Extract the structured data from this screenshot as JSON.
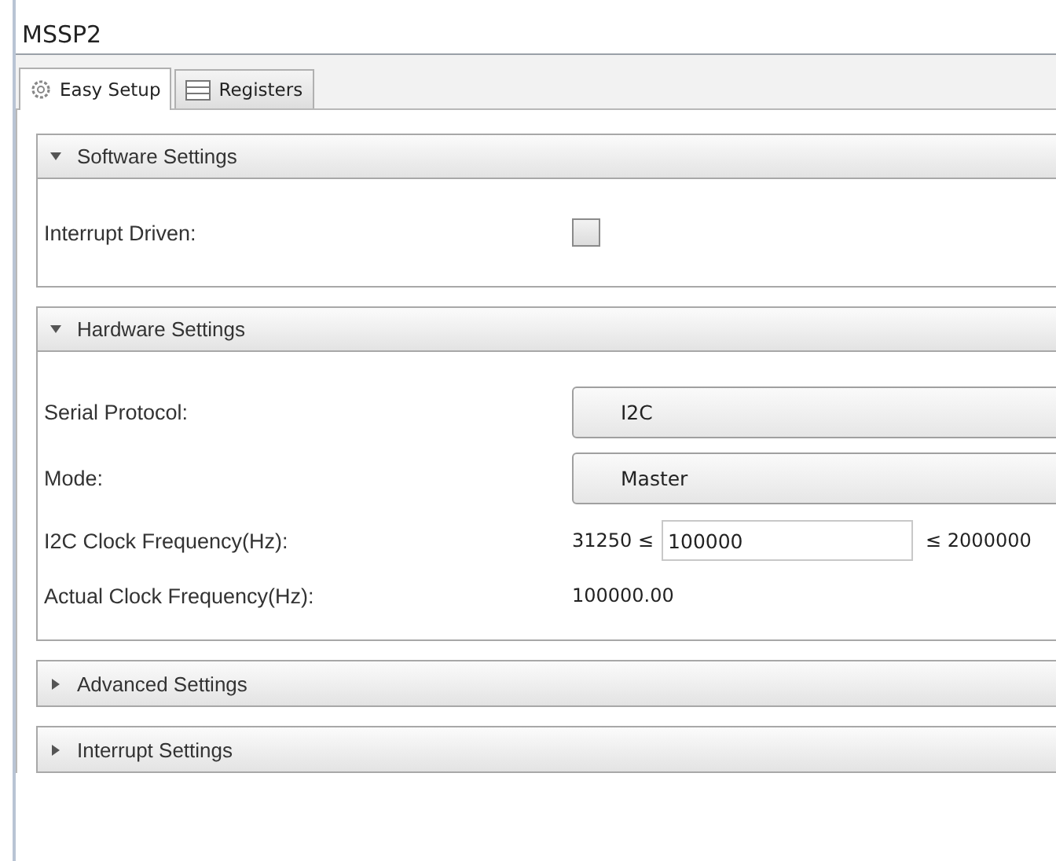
{
  "title": "MSSP2",
  "tabs": [
    {
      "label": "Easy Setup",
      "kind": "gear",
      "selected": true
    },
    {
      "label": "Registers",
      "kind": "list",
      "selected": false
    }
  ],
  "sections": [
    {
      "title": "Software Settings",
      "expanded": true,
      "rows": [
        {
          "kind": "checkbox",
          "label": "Interrupt Driven:",
          "checked": false
        }
      ]
    },
    {
      "title": "Hardware Settings",
      "expanded": true,
      "rows": [
        {
          "kind": "select",
          "label": "Serial Protocol:",
          "value": "I2C"
        },
        {
          "kind": "select",
          "label": "Mode:",
          "value": "Master"
        },
        {
          "kind": "range",
          "label": "I2C Clock Frequency(Hz):",
          "min": "31250 ≤",
          "value": "100000",
          "max": "≤ 2000000"
        },
        {
          "kind": "readout",
          "label": "Actual Clock Frequency(Hz):",
          "value": "100000.00"
        }
      ]
    },
    {
      "title": "Advanced Settings",
      "expanded": false
    },
    {
      "title": "Interrupt Settings",
      "expanded": false
    }
  ]
}
